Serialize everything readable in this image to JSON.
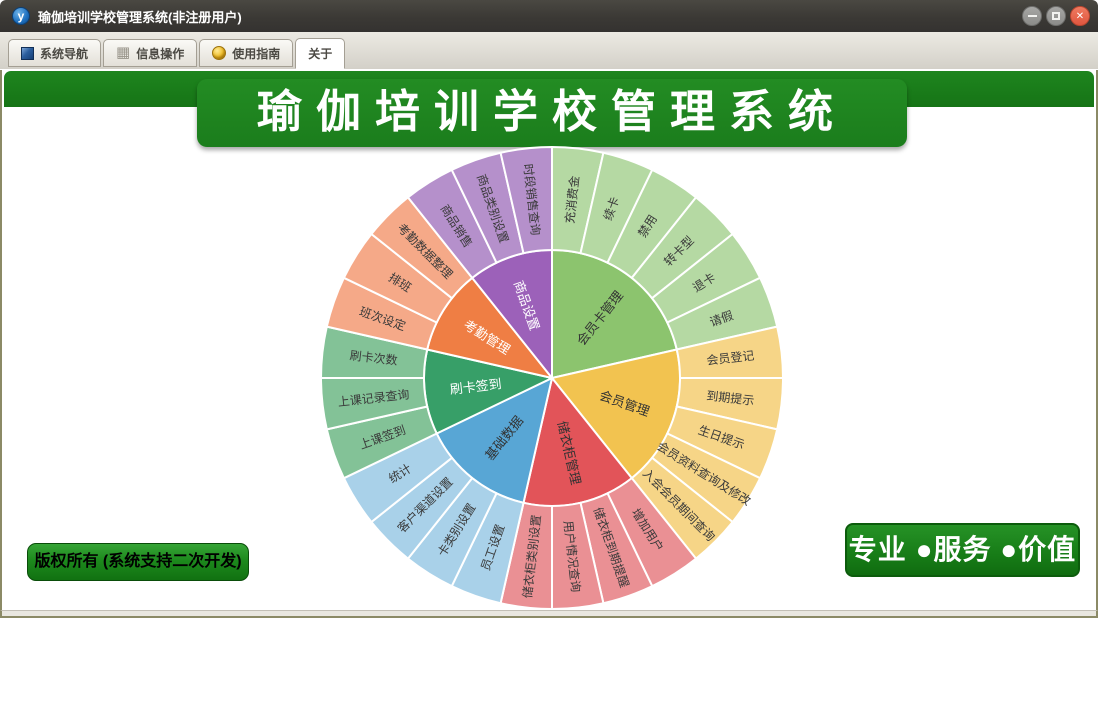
{
  "window": {
    "title": "瑜伽培训学校管理系统(非注册用户)",
    "app_icon_letter": "y",
    "controls": {
      "minimize": "minimize-icon",
      "maximize": "maximize-icon",
      "close": "close-icon"
    }
  },
  "toolbar": {
    "tabs": [
      {
        "label": "系统导航",
        "icon": "window-icon"
      },
      {
        "label": "信息操作",
        "icon": "grid-icon"
      },
      {
        "label": "使用指南",
        "icon": "coin-icon"
      },
      {
        "label": "关于",
        "icon": "none"
      }
    ],
    "active_tab": "关于"
  },
  "banner": {
    "title": "瑜伽培训学校管理系统"
  },
  "footer": {
    "copyright": "版权所有 (系统支持二次开发)",
    "slogan": "专业 ●服务 ●价值"
  },
  "chart_data": {
    "type": "pie",
    "subtype": "sunburst",
    "start_angle": "top",
    "direction": "clockwise",
    "inner_radius": 128,
    "outer_radius": 231,
    "stroke_color": "#ffffff",
    "outer_label_color": "#3a3a3a",
    "sections": [
      {
        "name": "会员卡管理",
        "color": "#8cc46e",
        "color_light": "#b5d9a3",
        "text_color": "#333333",
        "children": [
          "充消费金",
          "续卡",
          "禁用",
          "转卡型",
          "退卡",
          "请假"
        ]
      },
      {
        "name": "会员管理",
        "color": "#f2c350",
        "color_light": "#f6d587",
        "text_color": "#333333",
        "children": [
          "会员登记",
          "到期提示",
          "生日提示",
          "会员资料查询及修改",
          "入会会员期间查询"
        ]
      },
      {
        "name": "储衣柜管理",
        "color": "#e25459",
        "color_light": "#ea9094",
        "text_color": "#333333",
        "children": [
          "增加用户",
          "储衣柜到期提醒",
          "用户情况查询",
          "储衣柜类别设置"
        ]
      },
      {
        "name": "基础数据",
        "color": "#58a6d5",
        "color_light": "#a9d1e9",
        "text_color": "#333333",
        "children": [
          "员工设置",
          "卡类别设置",
          "客户渠道设置",
          "统计"
        ]
      },
      {
        "name": "刷卡签到",
        "color": "#379f68",
        "color_light": "#83c297",
        "text_color": "#ffffff",
        "children": [
          "上课签到",
          "上课记录查询",
          "刷卡次数"
        ]
      },
      {
        "name": "考勤管理",
        "color": "#ef7e44",
        "color_light": "#f5a988",
        "text_color": "#ffffff",
        "children": [
          "班次设定",
          "排班",
          "考勤数据整理"
        ]
      },
      {
        "name": "商品设置",
        "color": "#9c61b9",
        "color_light": "#b590cb",
        "text_color": "#ffffff",
        "children": [
          "商品销售",
          "商品类别设置",
          "时段销售查询"
        ]
      }
    ]
  }
}
